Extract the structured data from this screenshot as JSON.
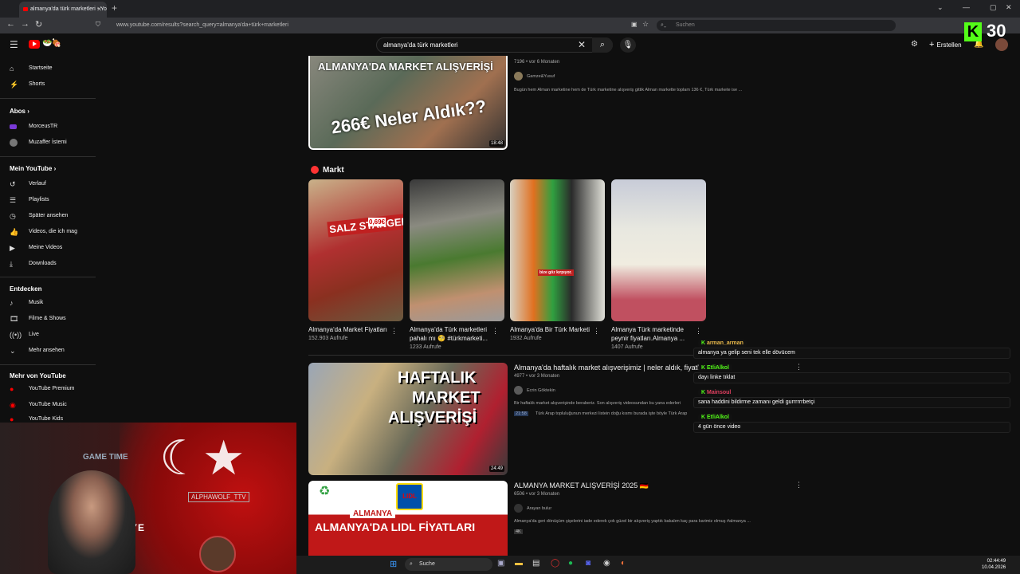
{
  "browser": {
    "tab_title": "almanya'da türk marketleri - Yo",
    "url": "www.youtube.com/results?search_query=almanya'da+türk+marketleri",
    "search_placeholder": "Suchen"
  },
  "youtube": {
    "search_query": "almanya'da türk marketleri",
    "create_label": "Erstellen",
    "sidebar": {
      "main": [
        {
          "label": "Startseite",
          "icon": "home-icon"
        },
        {
          "label": "Shorts",
          "icon": "shorts-icon"
        }
      ],
      "abos_title": "Abos",
      "abos": [
        {
          "label": "MorceusTR"
        },
        {
          "label": "Muzaffer İstemi"
        }
      ],
      "mine_title": "Mein YouTube",
      "mine": [
        {
          "label": "Verlauf"
        },
        {
          "label": "Playlists"
        },
        {
          "label": "Später ansehen"
        },
        {
          "label": "Videos, die ich mag"
        },
        {
          "label": "Meine Videos"
        },
        {
          "label": "Downloads"
        }
      ],
      "explore_title": "Entdecken",
      "explore": [
        {
          "label": "Musik"
        },
        {
          "label": "Filme & Shows"
        },
        {
          "label": "Live"
        },
        {
          "label": "Mehr ansehen"
        }
      ],
      "more_title": "Mehr von YouTube",
      "more": [
        {
          "label": "YouTube Premium"
        },
        {
          "label": "YouTube Music"
        },
        {
          "label": "YouTube Kids"
        }
      ]
    },
    "videos": [
      {
        "title": "",
        "meta": "7196 • vor 6 Monaten",
        "channel": "Gamze&Yusuf",
        "desc": "Bugün hem Alman marketine hem de Türk marketine alışveriş gittik Alman markette toplam 136 €, Türk markete ise ...",
        "duration": "18:48",
        "thumb_text1": "ALMANYA'DA MARKET ALIŞVERİŞİ",
        "thumb_text2": "266€ Neler Aldık??"
      },
      {
        "title": "Almanya'da haftalık market alışverişimiz | neler aldık, fiyatla",
        "meta": "4977 • vor 3 Monaten",
        "channel": "Ecrin Göktekin",
        "desc": "Bir haftalık market alışverişinde beraberiz. Son alışveriş videosundan bu yana ederleri",
        "chapter_time": "21:58",
        "chapter_text": "Türk Arap topluluğunun merkezi listein doğu kısmı burada işte böyle Türk Arap",
        "duration": "24:49",
        "thumb_text1": "HAFTALIK",
        "thumb_text2": "MARKET",
        "thumb_text3": "ALIŞVERİŞİ"
      },
      {
        "title": "ALMANYA MARKET ALIŞVERİŞİ 2025 🇩🇪",
        "meta": "6506 • vor 3 Monaten",
        "channel": "Arayan bulur",
        "desc": "Almanya'da geri dönüşüm şişelerini iade ederek çok güzel bir alışveriş yaptık bakalım kaç para karimiz olmuş #almanya ...",
        "badge": "4K",
        "thumb_text1": "ALMANYA",
        "thumb_text2": "ALMANYA'DA LIDL FİYATLARI",
        "thumb_logo": "LIDL"
      }
    ],
    "shorts_section": {
      "title": "Markt",
      "items": [
        {
          "title": "Almanya'da Market Fiyatları",
          "views": "152.903 Aufrufe",
          "thumb_text": "SALZ STANGEN",
          "price": "0,69€"
        },
        {
          "title": "Almanya'da Türk marketleri pahalı mı 🧐 #türkmarketi...",
          "views": "1233 Aufrufe"
        },
        {
          "title": "Almanya'da Bir Türk Marketi",
          "views": "1932 Aufrufe",
          "thumb_text": "bize göz kırpıyor."
        },
        {
          "title": "Almanya Türk marketinde peynir fiyatları.Almanya ...",
          "views": "1407 Aufrufe"
        }
      ]
    }
  },
  "chat": [
    {
      "user": "arman_arman",
      "user_color": "#e8b84a",
      "msg": "almanya ya gelip seni tek elle dövücem"
    },
    {
      "user": "EtliAlkol",
      "user_color": "#53fc18",
      "msg": "dayı linke tıklat"
    },
    {
      "user": "Mainsoul",
      "user_color": "#e04060",
      "msg": "sana haddini bildirme zamanı geldi gurrrrrrbetçi"
    },
    {
      "user": "EtliAlkol",
      "user_color": "#53fc18",
      "msg": "4 gün önce video"
    }
  ],
  "kick": {
    "count": "30"
  },
  "webcam": {
    "sign_text": "GAME TIME",
    "name_text": "ALPHAWOLF_TTV",
    "flag_text": "KIYE"
  },
  "taskbar": {
    "search_label": "Suche",
    "time": "02:44:49",
    "date": "10.04.2026"
  }
}
